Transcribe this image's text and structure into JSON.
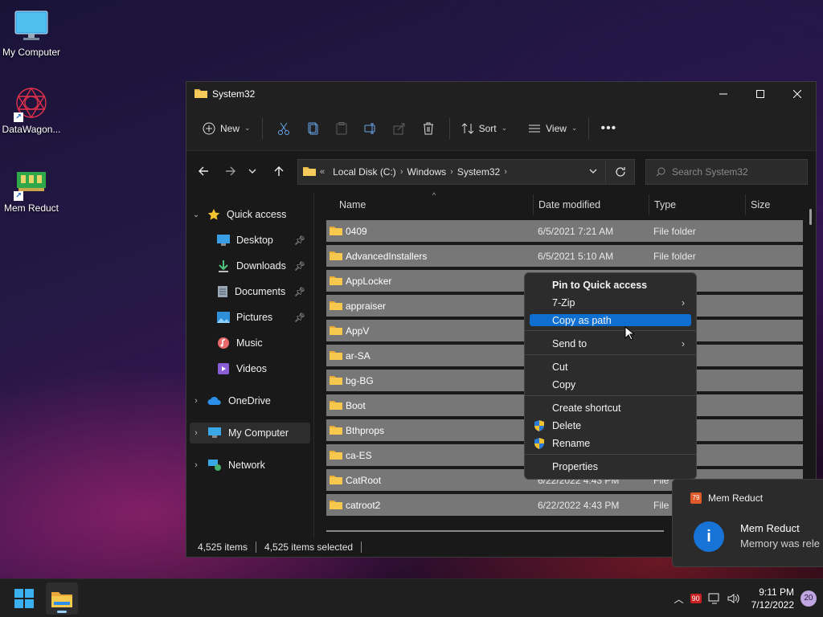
{
  "desktop": {
    "icons": [
      {
        "label": "My Computer"
      },
      {
        "label": "DataWagon..."
      },
      {
        "label": "Mem Reduct"
      }
    ]
  },
  "window": {
    "title": "System32",
    "toolbar": {
      "new_label": "New",
      "sort_label": "Sort",
      "view_label": "View"
    },
    "address": {
      "overflow": "«",
      "crumbs": [
        "Local Disk (C:)",
        "Windows",
        "System32"
      ]
    },
    "search": {
      "placeholder": "Search System32"
    },
    "nav": {
      "quick_access": "Quick access",
      "items": [
        "Desktop",
        "Downloads",
        "Documents",
        "Pictures",
        "Music",
        "Videos"
      ],
      "onedrive": "OneDrive",
      "my_computer": "My Computer",
      "network": "Network"
    },
    "columns": {
      "name": "Name",
      "date": "Date modified",
      "type": "Type",
      "size": "Size"
    },
    "files": [
      {
        "name": "0409",
        "date": "6/5/2021 7:21 AM",
        "type": "File folder"
      },
      {
        "name": "AdvancedInstallers",
        "date": "6/5/2021 5:10 AM",
        "type": "File folder"
      },
      {
        "name": "AppLocker",
        "date": "",
        "type": ""
      },
      {
        "name": "appraiser",
        "date": "",
        "type": ""
      },
      {
        "name": "AppV",
        "date": "",
        "type": ""
      },
      {
        "name": "ar-SA",
        "date": "",
        "type": ""
      },
      {
        "name": "bg-BG",
        "date": "",
        "type": ""
      },
      {
        "name": "Boot",
        "date": "",
        "type": ""
      },
      {
        "name": "Bthprops",
        "date": "",
        "type": ""
      },
      {
        "name": "ca-ES",
        "date": "",
        "type": ""
      },
      {
        "name": "CatRoot",
        "date": "6/22/2022 4:43 PM",
        "type": "File"
      },
      {
        "name": "catroot2",
        "date": "6/22/2022 4:43 PM",
        "type": "File"
      }
    ],
    "status": {
      "count": "4,525 items",
      "selected": "4,525 items selected"
    }
  },
  "context_menu": {
    "items": [
      "Pin to Quick access",
      "7-Zip",
      "Copy as path",
      "Send to",
      "Cut",
      "Copy",
      "Create shortcut",
      "Delete",
      "Rename",
      "Properties"
    ],
    "highlighted": "Copy as path"
  },
  "notification": {
    "app": "Mem Reduct",
    "app_badge": "79",
    "title": "Mem Reduct",
    "body": "Memory was rele"
  },
  "taskbar": {
    "tray_badge": "90",
    "time": "9:11 PM",
    "date": "7/12/2022",
    "notif_count": "20"
  },
  "colors": {
    "accent": "#0f6fd0",
    "selected_row": "#777777",
    "folder": "#e8b84a"
  }
}
